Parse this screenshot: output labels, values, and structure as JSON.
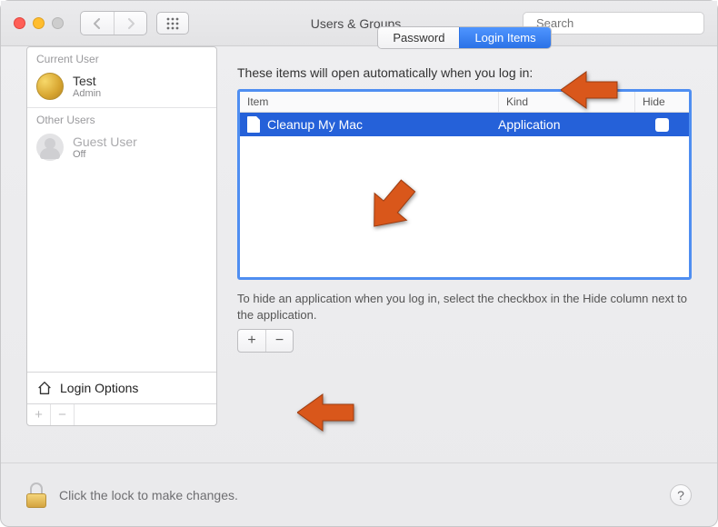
{
  "window": {
    "title": "Users & Groups",
    "search_placeholder": "Search"
  },
  "sidebar": {
    "section_current": "Current User",
    "section_other": "Other Users",
    "current_user": {
      "name": "Test",
      "role": "Admin"
    },
    "other_user": {
      "name": "Guest User",
      "status": "Off"
    },
    "login_options_label": "Login Options"
  },
  "tabs": {
    "password": "Password",
    "login_items": "Login Items"
  },
  "main": {
    "description": "These items will open automatically when you log in:",
    "columns": {
      "item": "Item",
      "kind": "Kind",
      "hide": "Hide"
    },
    "rows": [
      {
        "name": "Cleanup My Mac",
        "kind": "Application",
        "hide": false
      }
    ],
    "hint": "To hide an application when you log in, select the checkbox in the Hide column next to the application."
  },
  "footer": {
    "lock_text": "Click the lock to make changes.",
    "help_label": "?"
  },
  "buttons": {
    "plus": "+",
    "minus": "−"
  }
}
